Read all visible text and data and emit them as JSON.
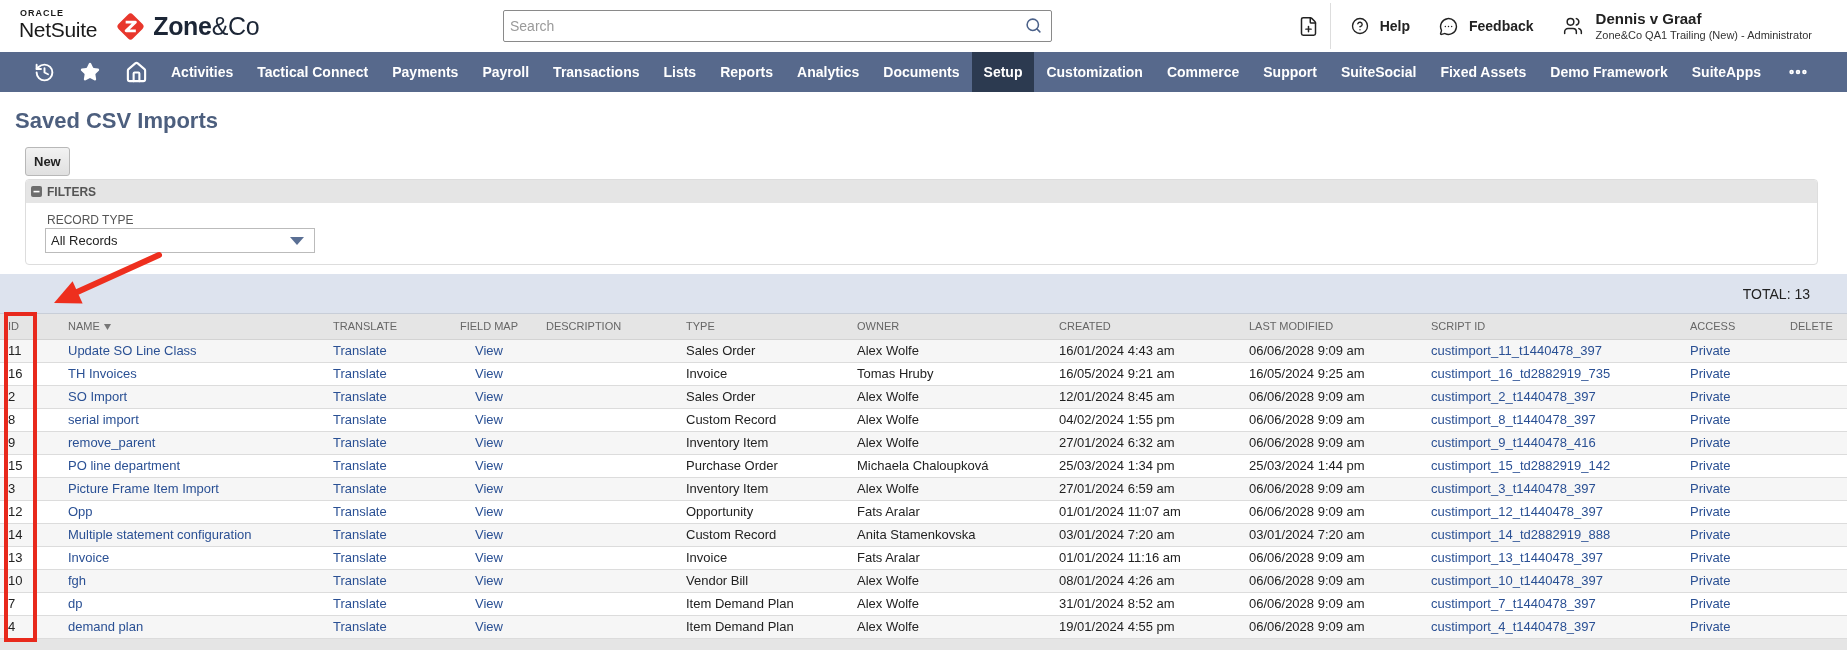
{
  "header": {
    "logo": {
      "small": "ORACLE",
      "name": "NetSuite"
    },
    "brand": "**Zone**&Co",
    "search": {
      "placeholder": "Search"
    },
    "links": [
      {
        "kind": "help",
        "label": "Help"
      },
      {
        "kind": "feedback",
        "label": "Feedback"
      }
    ],
    "user": {
      "name": "Dennis v Graaf",
      "role": "Zone&Co QA1 Trailing (New) - Administrator"
    }
  },
  "nav": {
    "items": [
      {
        "label": "Activities",
        "selected": false
      },
      {
        "label": "Tactical Connect",
        "selected": false
      },
      {
        "label": "Payments",
        "selected": false
      },
      {
        "label": "Payroll",
        "selected": false
      },
      {
        "label": "Transactions",
        "selected": false
      },
      {
        "label": "Lists",
        "selected": false
      },
      {
        "label": "Reports",
        "selected": false
      },
      {
        "label": "Analytics",
        "selected": false
      },
      {
        "label": "Documents",
        "selected": false
      },
      {
        "label": "Setup",
        "selected": true
      },
      {
        "label": "Customization",
        "selected": false
      },
      {
        "label": "Commerce",
        "selected": false
      },
      {
        "label": "Support",
        "selected": false
      },
      {
        "label": "SuiteSocial",
        "selected": false
      },
      {
        "label": "Fixed Assets",
        "selected": false
      },
      {
        "label": "Demo Framework",
        "selected": false
      },
      {
        "label": "SuiteApps",
        "selected": false
      }
    ]
  },
  "page": {
    "title": "Saved CSV Imports",
    "new_button": "New",
    "filters": {
      "title": "FILTERS",
      "expanded": true,
      "record_type": {
        "label": "RECORD TYPE",
        "value": "All Records"
      }
    }
  },
  "list": {
    "total": "TOTAL: 13",
    "columns": [
      {
        "label": "ID",
        "kind": "text",
        "sorted": false
      },
      {
        "label": "NAME",
        "kind": "link",
        "sorted": true
      },
      {
        "label": "TRANSLATE",
        "kind": "link",
        "sorted": false
      },
      {
        "label": "FIELD MAP",
        "kind": "link",
        "sorted": false
      },
      {
        "label": "DESCRIPTION",
        "kind": "text",
        "sorted": false
      },
      {
        "label": "TYPE",
        "kind": "text",
        "sorted": false
      },
      {
        "label": "OWNER",
        "kind": "text",
        "sorted": false
      },
      {
        "label": "CREATED",
        "kind": "text",
        "sorted": false
      },
      {
        "label": "LAST MODIFIED",
        "kind": "text",
        "sorted": false
      },
      {
        "label": "SCRIPT ID",
        "kind": "link",
        "sorted": false
      },
      {
        "label": "ACCESS",
        "kind": "link",
        "sorted": false
      },
      {
        "label": "DELETE",
        "kind": "text",
        "sorted": false
      }
    ],
    "rows": [
      {
        "id": "11",
        "name": "Update SO Line Class",
        "translate": "Translate",
        "field_map": "View",
        "type": "Sales Order",
        "owner": "Alex Wolfe",
        "created": "16/01/2024 4:43 am",
        "last_modified": "06/06/2028 9:09 am",
        "script_id": "custimport_11_t1440478_397",
        "access": "Private"
      },
      {
        "id": "16",
        "name": "TH Invoices",
        "translate": "Translate",
        "field_map": "View",
        "type": "Invoice",
        "owner": "Tomas Hruby",
        "created": "16/05/2024 9:21 am",
        "last_modified": "16/05/2024 9:25 am",
        "script_id": "custimport_16_td2882919_735",
        "access": "Private"
      },
      {
        "id": "2",
        "name": "SO Import",
        "translate": "Translate",
        "field_map": "View",
        "type": "Sales Order",
        "owner": "Alex Wolfe",
        "created": "12/01/2024 8:45 am",
        "last_modified": "06/06/2028 9:09 am",
        "script_id": "custimport_2_t1440478_397",
        "access": "Private"
      },
      {
        "id": "8",
        "name": "serial import",
        "translate": "Translate",
        "field_map": "View",
        "type": "Custom Record",
        "owner": "Alex Wolfe",
        "created": "04/02/2024 1:55 pm",
        "last_modified": "06/06/2028 9:09 am",
        "script_id": "custimport_8_t1440478_397",
        "access": "Private"
      },
      {
        "id": "9",
        "name": "remove_parent",
        "translate": "Translate",
        "field_map": "View",
        "type": "Inventory Item",
        "owner": "Alex Wolfe",
        "created": "27/01/2024 6:32 am",
        "last_modified": "06/06/2028 9:09 am",
        "script_id": "custimport_9_t1440478_416",
        "access": "Private"
      },
      {
        "id": "15",
        "name": "PO line department",
        "translate": "Translate",
        "field_map": "View",
        "type": "Purchase Order",
        "owner": "Michaela Chaloupková",
        "created": "25/03/2024 1:34 pm",
        "last_modified": "25/03/2024 1:44 pm",
        "script_id": "custimport_15_td2882919_142",
        "access": "Private"
      },
      {
        "id": "3",
        "name": "Picture Frame Item Import",
        "translate": "Translate",
        "field_map": "View",
        "type": "Inventory Item",
        "owner": "Alex Wolfe",
        "created": "27/01/2024 6:59 am",
        "last_modified": "06/06/2028 9:09 am",
        "script_id": "custimport_3_t1440478_397",
        "access": "Private"
      },
      {
        "id": "12",
        "name": "Opp",
        "translate": "Translate",
        "field_map": "View",
        "type": "Opportunity",
        "owner": "Fats Aralar",
        "created": "01/01/2024 11:07 am",
        "last_modified": "06/06/2028 9:09 am",
        "script_id": "custimport_12_t1440478_397",
        "access": "Private"
      },
      {
        "id": "14",
        "name": "Multiple statement configuration",
        "translate": "Translate",
        "field_map": "View",
        "type": "Custom Record",
        "owner": "Anita Stamenkovska",
        "created": "03/01/2024 7:20 am",
        "last_modified": "03/01/2024 7:20 am",
        "script_id": "custimport_14_td2882919_888",
        "access": "Private"
      },
      {
        "id": "13",
        "name": "Invoice",
        "translate": "Translate",
        "field_map": "View",
        "type": "Invoice",
        "owner": "Fats Aralar",
        "created": "01/01/2024 11:16 am",
        "last_modified": "06/06/2028 9:09 am",
        "script_id": "custimport_13_t1440478_397",
        "access": "Private"
      },
      {
        "id": "10",
        "name": "fgh",
        "translate": "Translate",
        "field_map": "View",
        "type": "Vendor Bill",
        "owner": "Alex Wolfe",
        "created": "08/01/2024 4:26 am",
        "last_modified": "06/06/2028 9:09 am",
        "script_id": "custimport_10_t1440478_397",
        "access": "Private"
      },
      {
        "id": "7",
        "name": "dp",
        "translate": "Translate",
        "field_map": "View",
        "type": "Item Demand Plan",
        "owner": "Alex Wolfe",
        "created": "31/01/2024 8:52 am",
        "last_modified": "06/06/2028 9:09 am",
        "script_id": "custimport_7_t1440478_397",
        "access": "Private"
      },
      {
        "id": "4",
        "name": "demand plan",
        "translate": "Translate",
        "field_map": "View",
        "type": "Item Demand Plan",
        "owner": "Alex Wolfe",
        "created": "19/01/2024 4:55 pm",
        "last_modified": "06/06/2028 9:09 am",
        "script_id": "custimport_4_t1440478_397",
        "access": "Private"
      }
    ]
  },
  "annotations": {
    "arrow": true,
    "column_frame": true
  }
}
